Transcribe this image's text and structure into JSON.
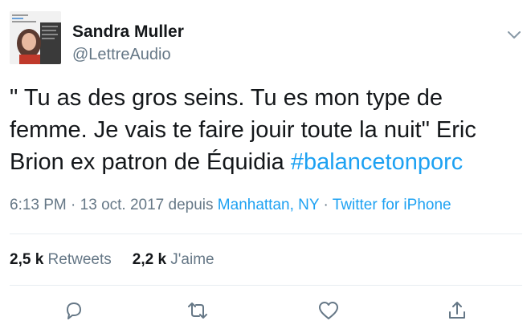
{
  "author": {
    "name": "Sandra Muller",
    "handle": "@LettreAudio"
  },
  "tweet": {
    "text": "\" Tu as des gros seins. Tu es mon type de femme. Je vais te faire jouir toute la nuit\" Eric Brion ex patron de Équidia ",
    "hashtag": "#balancetonporc"
  },
  "meta": {
    "time": "6:13 PM",
    "sep1": " · ",
    "date": "13 oct. 2017",
    "via": " depuis ",
    "location": "Manhattan, NY",
    "sep2": " · ",
    "client": "Twitter for iPhone"
  },
  "stats": {
    "retweets_count": "2,5 k",
    "retweets_label": "Retweets",
    "likes_count": "2,2 k",
    "likes_label": "J'aime"
  },
  "colors": {
    "link": "#1da1f2",
    "secondary_text": "#657786",
    "primary_text": "#14171a",
    "divider": "#e6ecf0"
  },
  "icons": {
    "caret": "chevron-down-icon",
    "reply": "reply-icon",
    "retweet": "retweet-icon",
    "like": "heart-icon",
    "share": "share-icon"
  }
}
